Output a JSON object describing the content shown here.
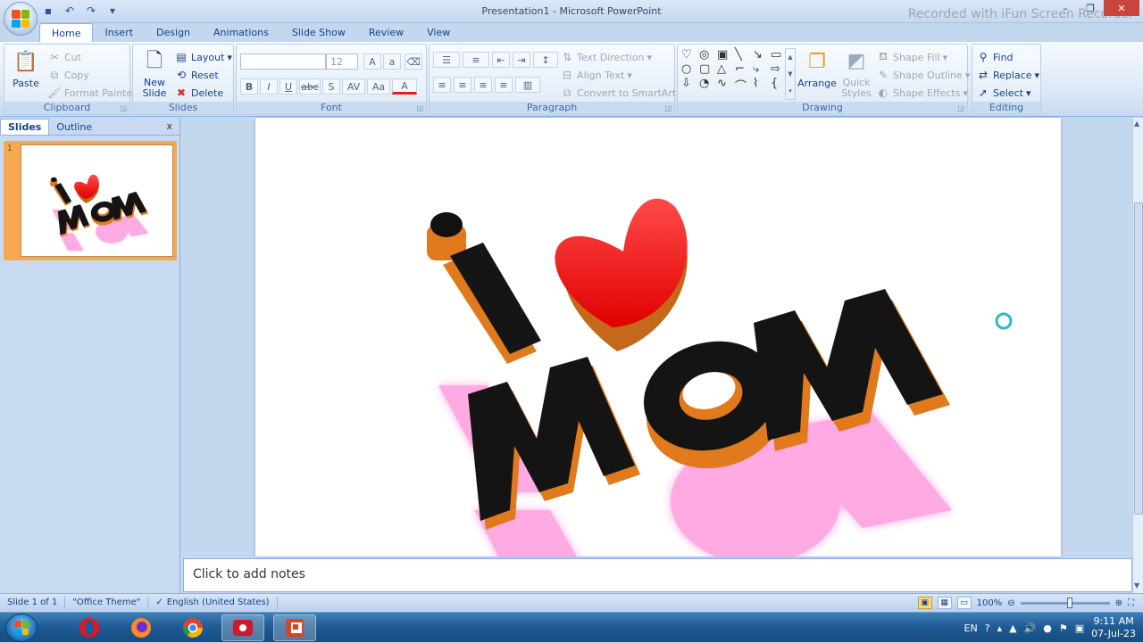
{
  "window": {
    "title": "Presentation1 - Microsoft PowerPoint",
    "watermark": "Recorded with iFun Screen Recorder"
  },
  "tabs": [
    "Home",
    "Insert",
    "Design",
    "Animations",
    "Slide Show",
    "Review",
    "View"
  ],
  "ribbon": {
    "clipboard": {
      "label": "Clipboard",
      "paste": "Paste",
      "cut": "Cut",
      "copy": "Copy",
      "format_painter": "Format Painter"
    },
    "slides": {
      "label": "Slides",
      "new_slide": "New Slide",
      "layout": "Layout",
      "reset": "Reset",
      "delete": "Delete"
    },
    "font": {
      "label": "Font",
      "font_name": "",
      "font_size": "12",
      "bold": "B",
      "italic": "I",
      "underline": "U",
      "strike": "abc",
      "shadow": "S",
      "spacing": "AV",
      "case": "Aa",
      "color": "A"
    },
    "paragraph": {
      "label": "Paragraph",
      "text_direction": "Text Direction",
      "align_text": "Align Text",
      "convert_smartart": "Convert to SmartArt"
    },
    "drawing": {
      "label": "Drawing",
      "arrange": "Arrange",
      "quick_styles": "Quick Styles",
      "shape_fill": "Shape Fill",
      "shape_outline": "Shape Outline",
      "shape_effects": "Shape Effects"
    },
    "editing": {
      "label": "Editing",
      "find": "Find",
      "replace": "Replace",
      "select": "Select"
    }
  },
  "left_pane": {
    "tab_slides": "Slides",
    "tab_outline": "Outline",
    "close": "x",
    "slide_number": "1"
  },
  "slide_art": {
    "letter_i": "I",
    "word": "MOM",
    "colors": {
      "face": "#111111",
      "side": "#e07a1c",
      "glow": "#ff66cc",
      "heart": "#ff1a1a"
    }
  },
  "notes": {
    "placeholder": "Click to add notes"
  },
  "status": {
    "slide_of": "Slide 1 of 1",
    "theme": "\"Office Theme\"",
    "language": "English (United States)",
    "zoom": "100%"
  },
  "tray": {
    "lang": "EN",
    "time": "9:11 AM",
    "date": "07-Jul-23"
  }
}
